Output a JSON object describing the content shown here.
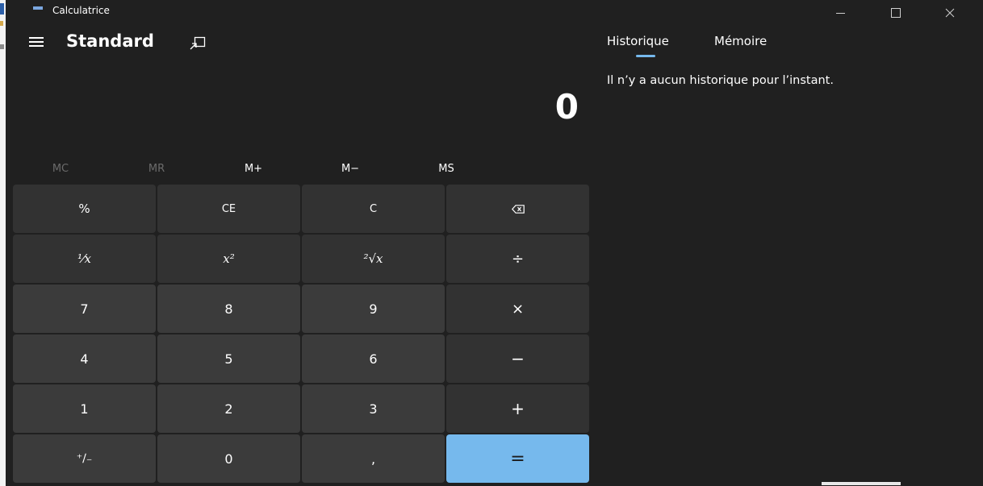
{
  "window": {
    "title": "Calculatrice",
    "icon": "calculator-icon",
    "controls": {
      "minimize": "minimize-icon",
      "maximize": "maximize-icon",
      "close": "close-icon"
    }
  },
  "header": {
    "menu_icon": "hamburger-icon",
    "mode": "Standard",
    "keep_on_top_icon": "keep-on-top-icon"
  },
  "display": {
    "value": "0"
  },
  "memory": {
    "buttons": [
      {
        "label": "MC",
        "enabled": false
      },
      {
        "label": "MR",
        "enabled": false
      },
      {
        "label": "M+",
        "enabled": true
      },
      {
        "label": "M−",
        "enabled": true
      },
      {
        "label": "MS",
        "enabled": true
      }
    ]
  },
  "keys": {
    "percent": "%",
    "clear_entry": "CE",
    "clear": "C",
    "backspace": "⌫",
    "reciprocal": "¹⁄x",
    "square": "x²",
    "sqrt": "²√x",
    "divide": "÷",
    "seven": "7",
    "eight": "8",
    "nine": "9",
    "multiply": "×",
    "four": "4",
    "five": "5",
    "six": "6",
    "minus": "−",
    "one": "1",
    "two": "2",
    "three": "3",
    "plus": "+",
    "negate": "⁺∕₋",
    "zero": "0",
    "decimal": ",",
    "equals": "="
  },
  "side_panel": {
    "tabs": [
      "Historique",
      "Mémoire"
    ],
    "active_tab": "Historique",
    "empty_message": "Il n’y a aucun historique pour l’instant."
  },
  "colors": {
    "background": "#202020",
    "key": "#3b3b3b",
    "function_key": "#323232",
    "accent": "#76b9ed"
  }
}
